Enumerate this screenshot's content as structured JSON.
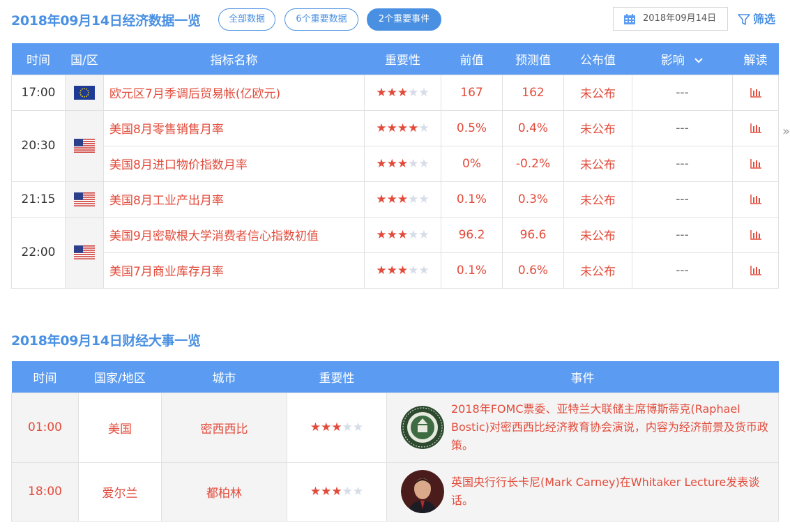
{
  "header": {
    "title": "2018年09月14日经济数据一览",
    "pills": [
      "全部数据",
      "6个重要数据",
      "2个重要事件"
    ],
    "date": "2018年09月14日",
    "filter_label": "筛选"
  },
  "econ_table": {
    "columns": [
      "时间",
      "国/区",
      "指标名称",
      "重要性",
      "前值",
      "预测值",
      "公布值",
      "影响",
      "解读"
    ],
    "rows": [
      {
        "time": "17:00",
        "country": "eu",
        "name": "欧元区7月季调后贸易帐(亿欧元)",
        "stars": 3,
        "prev": "167",
        "forecast": "162",
        "actual": "未公布",
        "impact": "---"
      },
      {
        "time": "20:30",
        "country": "us",
        "name": "美国8月零售销售月率",
        "stars": 4,
        "prev": "0.5%",
        "forecast": "0.4%",
        "actual": "未公布",
        "impact": "---"
      },
      {
        "time": "",
        "country": "",
        "name": "美国8月进口物价指数月率",
        "stars": 3,
        "prev": "0%",
        "forecast": "-0.2%",
        "actual": "未公布",
        "impact": "---"
      },
      {
        "time": "21:15",
        "country": "us",
        "name": "美国8月工业产出月率",
        "stars": 3,
        "prev": "0.1%",
        "forecast": "0.3%",
        "actual": "未公布",
        "impact": "---"
      },
      {
        "time": "22:00",
        "country": "us",
        "name": "美国9月密歇根大学消费者信心指数初值",
        "stars": 3,
        "prev": "96.2",
        "forecast": "96.6",
        "actual": "未公布",
        "impact": "---"
      },
      {
        "time": "",
        "country": "",
        "name": "美国7月商业库存月率",
        "stars": 3,
        "prev": "0.1%",
        "forecast": "0.6%",
        "actual": "未公布",
        "impact": "---"
      }
    ]
  },
  "events_section": {
    "title": "2018年09月14日财经大事一览",
    "columns": [
      "时间",
      "国家/地区",
      "城市",
      "重要性",
      "事件"
    ],
    "rows": [
      {
        "time": "01:00",
        "country": "美国",
        "city": "密西西比",
        "stars": 3,
        "image": "federal-reserve-seal",
        "event": "2018年FOMC票委、亚特兰大联储主席博斯蒂克(Raphael Bostic)对密西西比经济教育协会演说，内容为经济前景及货币政策。"
      },
      {
        "time": "18:00",
        "country": "爱尔兰",
        "city": "都柏林",
        "stars": 3,
        "image": "mark-carney-portrait",
        "event": "英国央行行长卡尼(Mark Carney)在Whitaker Lecture发表谈话。"
      }
    ]
  },
  "colors": {
    "accent": "#4a90e2",
    "header_bg": "#5b9cf2",
    "red": "#e24b3b",
    "star_off": "#d6dde8"
  }
}
